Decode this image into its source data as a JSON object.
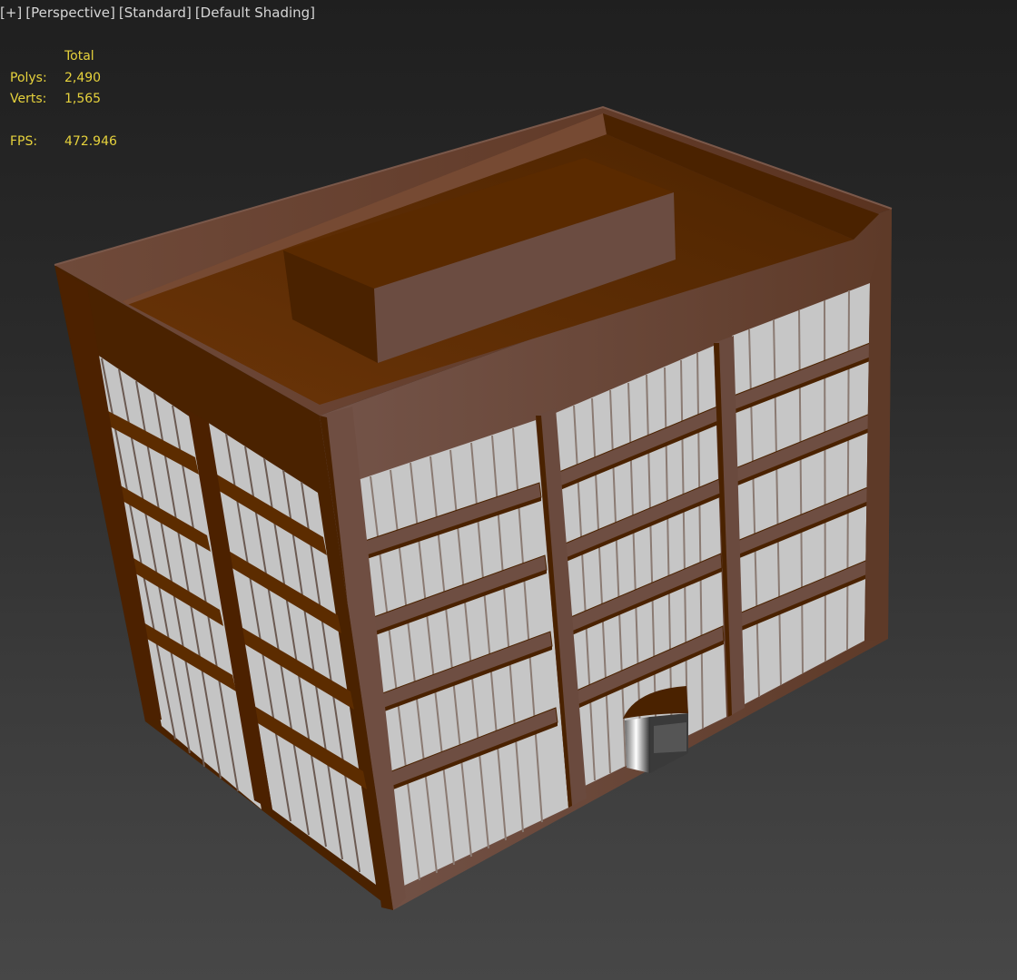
{
  "viewport": {
    "labels": {
      "plus": "[+]",
      "view": "[Perspective]",
      "mode": "[Standard]",
      "shading": "[Default Shading]"
    }
  },
  "stats": {
    "header": "Total",
    "rows": [
      {
        "label": "Polys:",
        "value": "2,490"
      },
      {
        "label": "Verts:",
        "value": "1,565"
      }
    ],
    "fps_label": "FPS:",
    "fps_value": "472.946"
  },
  "colors": {
    "stats_text": "#e6d23c",
    "header_text": "#d6d6d6",
    "building_dark": "#4a2200",
    "building_mid": "#5c2c00",
    "building_light": "#6d5047",
    "glass": "#c6c6c6",
    "mullion": "#5a4438"
  },
  "scene": {
    "object": "office-building",
    "floors": 5,
    "bays_front": 3,
    "bays_side": 2
  }
}
